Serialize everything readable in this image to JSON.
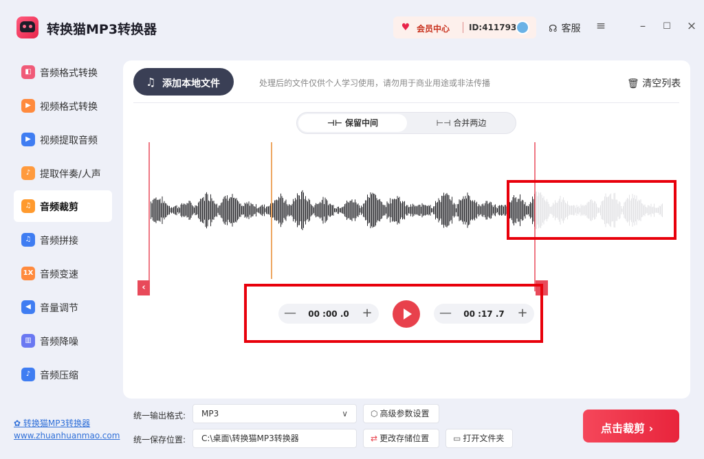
{
  "app": {
    "title": "转换猫MP3转换器",
    "vip_label": "会员中心",
    "user_id": "ID:411793",
    "service_label": "客服",
    "menu_icon": "menu-icon",
    "minimize_icon": "minimize-icon",
    "maximize_icon": "maximize-icon",
    "close_icon": "close-icon"
  },
  "sidebar": {
    "items": [
      {
        "label": "音频格式转换",
        "icon": "audio-format-icon",
        "color": "#f05a78"
      },
      {
        "label": "视频格式转换",
        "icon": "video-format-icon",
        "color": "#ff8a3d"
      },
      {
        "label": "视频提取音频",
        "icon": "video-extract-icon",
        "color": "#3f7df2"
      },
      {
        "label": "提取伴奏/人声",
        "icon": "vocal-extract-icon",
        "color": "#ff9a3d"
      },
      {
        "label": "音频裁剪",
        "icon": "audio-cut-icon",
        "color": "#ff9a2e"
      },
      {
        "label": "音频拼接",
        "icon": "audio-join-icon",
        "color": "#3f7df2"
      },
      {
        "label": "音频变速",
        "icon": "audio-speed-icon",
        "color": "#ff8a3d"
      },
      {
        "label": "音量调节",
        "icon": "volume-icon",
        "color": "#3f7df2"
      },
      {
        "label": "音频降噪",
        "icon": "denoise-icon",
        "color": "#6a78f2"
      },
      {
        "label": "音频压缩",
        "icon": "compress-icon",
        "color": "#3f7df2"
      }
    ],
    "active_index": 4,
    "speed_badge": "1X",
    "brand_link": "转换猫MP3转换器",
    "brand_url": "www.zhuanhuanmao.com"
  },
  "main": {
    "add_button": "添加本地文件",
    "notice": "处理后的文件仅供个人学习使用，请勿用于商业用途或非法传播",
    "clear_button": "清空列表",
    "mode_keep_middle": "保留中间",
    "mode_merge_sides": "合并两边",
    "start_time": "00 :00 .0",
    "end_time": "00 :17 .7",
    "minus_symbol": "—",
    "plus_symbol": "+"
  },
  "bottom": {
    "format_label": "统一输出格式:",
    "format_value": "MP3",
    "advanced_button": "高级参数设置",
    "save_label": "统一保存位置:",
    "save_value": "C:\\桌面\\转换猫MP3转换器",
    "change_save_button": "更改存储位置",
    "open_folder_button": "打开文件夹",
    "cut_button": "点击裁剪 ›"
  },
  "colors": {
    "accent": "#e8414c",
    "highlight_box": "#e8000b",
    "playhead": "#e98a2e",
    "wave_selected": "#2a2a2e",
    "wave_unselected": "#e2e2e4"
  }
}
